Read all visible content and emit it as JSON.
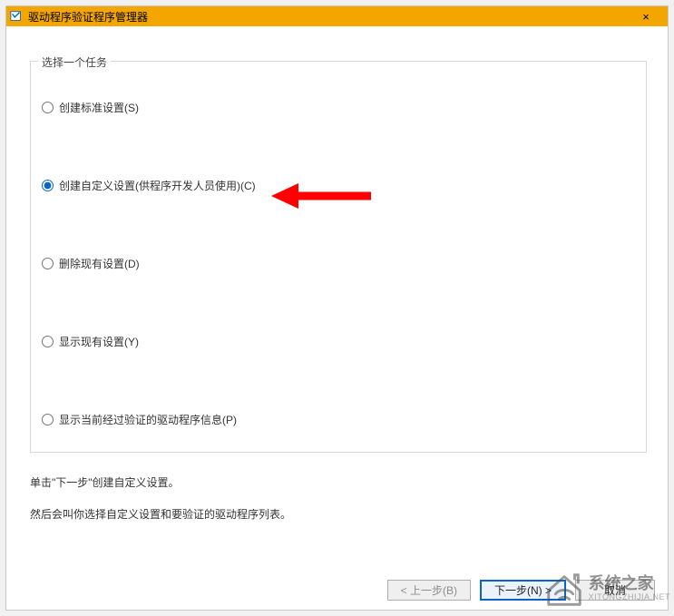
{
  "window": {
    "title": "驱动程序验证程序管理器",
    "close_label": "×"
  },
  "group": {
    "legend": "选择一个任务",
    "selected": 1,
    "options": [
      {
        "label": "创建标准设置(S)"
      },
      {
        "label": "创建自定义设置(供程序开发人员使用)(C)"
      },
      {
        "label": "删除现有设置(D)"
      },
      {
        "label": "显示现有设置(Y)"
      },
      {
        "label": "显示当前经过验证的驱动程序信息(P)"
      }
    ]
  },
  "hints": {
    "line1": "单击\"下一步\"创建自定义设置。",
    "line2": "然后会叫你选择自定义设置和要验证的驱动程序列表。"
  },
  "buttons": {
    "back": "< 上一步(B)",
    "next": "下一步(N) >",
    "cancel": "取消"
  },
  "watermark": {
    "cn": "系统之家",
    "en": "XITONGZHIJIA.NET"
  }
}
